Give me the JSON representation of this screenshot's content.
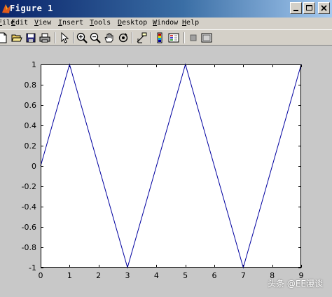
{
  "window": {
    "title": "Figure 1"
  },
  "menu": [
    {
      "label": "File",
      "key": "F"
    },
    {
      "label": "Edit",
      "key": "E"
    },
    {
      "label": "View",
      "key": "V"
    },
    {
      "label": "Insert",
      "key": "I"
    },
    {
      "label": "Tools",
      "key": "T"
    },
    {
      "label": "Desktop",
      "key": "D"
    },
    {
      "label": "Window",
      "key": "W"
    },
    {
      "label": "Help",
      "key": "H"
    }
  ],
  "toolbar": [
    "new-figure-icon",
    "open-file-icon",
    "save-icon",
    "print-icon",
    "edit-plot-arrow-icon",
    "zoom-in-icon",
    "zoom-out-icon",
    "pan-hand-icon",
    "rotate-3d-icon",
    "data-cursor-icon",
    "colorbar-icon",
    "legend-icon",
    "hide-plot-tools-icon",
    "show-plot-tools-icon"
  ],
  "watermark": "头条 @EE漫谈",
  "colors": {
    "line": "#0000a0",
    "axes_bg": "#ffffff",
    "figure_bg": "#c8c8c8"
  },
  "chart_data": {
    "type": "line",
    "title": "",
    "xlabel": "",
    "ylabel": "",
    "xlim": [
      0,
      9
    ],
    "ylim": [
      -1,
      1
    ],
    "grid": false,
    "xticks": [
      0,
      1,
      2,
      3,
      4,
      5,
      6,
      7,
      8,
      9
    ],
    "yticks": [
      1,
      0.8,
      0.6,
      0.4,
      0.2,
      0,
      -0.2,
      -0.4,
      -0.6,
      -0.8,
      -1
    ],
    "series": [
      {
        "x": [
          0,
          1,
          3,
          5,
          7,
          9
        ],
        "y": [
          0,
          1,
          -1,
          1,
          -1,
          1
        ]
      }
    ]
  }
}
